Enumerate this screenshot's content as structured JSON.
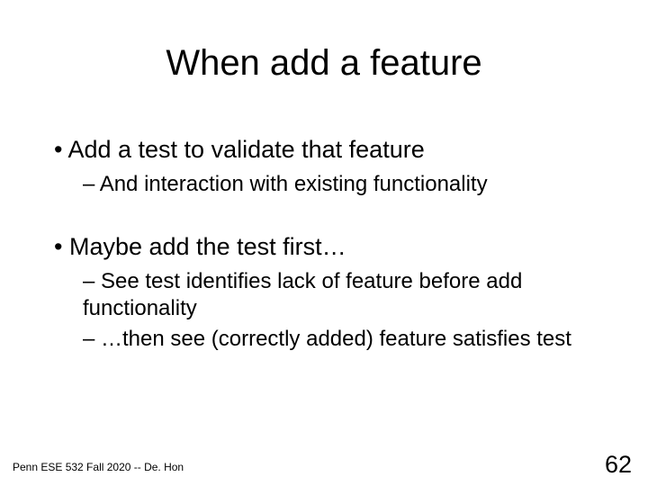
{
  "title": "When add a feature",
  "bullets": {
    "b1a": "Add a test to validate that feature",
    "b2a": "And interaction with existing functionality",
    "b1b": "Maybe add the test first…",
    "b2b": "See test identifies lack of feature before add functionality",
    "b2c": "…then see (correctly added) feature satisfies test"
  },
  "footer": {
    "left": "Penn ESE 532 Fall 2020 -- De. Hon",
    "page": "62"
  }
}
